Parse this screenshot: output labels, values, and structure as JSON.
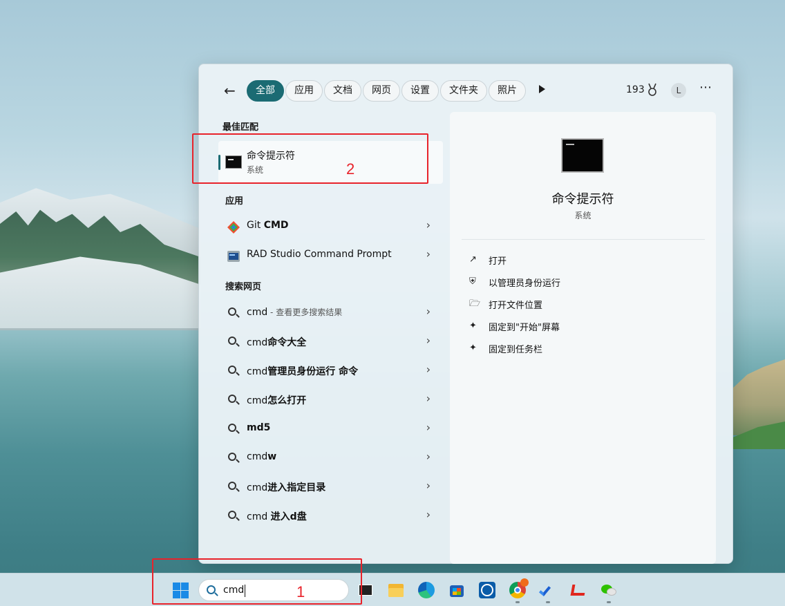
{
  "filters": {
    "items": [
      "全部",
      "应用",
      "文档",
      "网页",
      "设置",
      "文件夹",
      "照片"
    ],
    "points": "193",
    "avatar": "L"
  },
  "best_match": {
    "heading": "最佳匹配",
    "title": "命令提示符",
    "subtitle": "系统"
  },
  "apps": {
    "heading": "应用",
    "items": [
      {
        "pre": "Git ",
        "bold": "CMD"
      },
      {
        "pre": "RAD Studio Command Prompt",
        "bold": ""
      }
    ]
  },
  "web": {
    "heading": "搜索网页",
    "items": [
      {
        "pre": "cmd",
        "bold": "",
        "hint": " - 查看更多搜索结果"
      },
      {
        "pre": "cmd",
        "bold": "命令大全",
        "hint": ""
      },
      {
        "pre": "cmd",
        "bold": "管理员身份运行 命令",
        "hint": ""
      },
      {
        "pre": "cmd",
        "bold": "怎么打开",
        "hint": ""
      },
      {
        "pre": "",
        "bold": "md5",
        "hint": ""
      },
      {
        "pre": "cmd",
        "bold": "w",
        "hint": ""
      },
      {
        "pre": "cmd",
        "bold": "进入指定目录",
        "hint": ""
      },
      {
        "pre": "cmd ",
        "bold": "进入d盘",
        "hint": ""
      }
    ]
  },
  "detail": {
    "title": "命令提示符",
    "subtitle": "系统",
    "actions": [
      "打开",
      "以管理员身份运行",
      "打开文件位置",
      "固定到\"开始\"屏幕",
      "固定到任务栏"
    ]
  },
  "taskbar": {
    "search_value": "cmd"
  },
  "annotations": {
    "label1": "1",
    "label2": "2",
    "color": "#e8222a"
  },
  "colors": {
    "accent": "#1b6b73"
  }
}
